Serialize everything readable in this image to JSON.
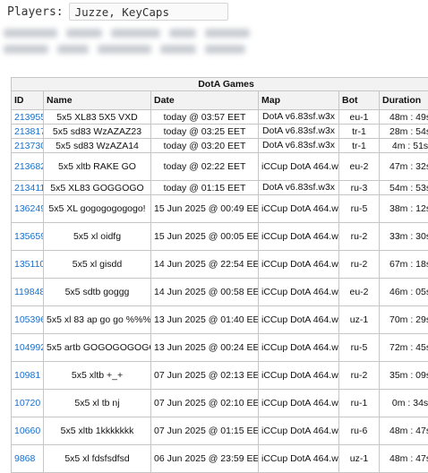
{
  "players": {
    "label": "Players:",
    "value": "Juzze, KeyCaps"
  },
  "table": {
    "caption": "DotA Games",
    "columns": [
      "ID",
      "Name",
      "Date",
      "Map",
      "Bot",
      "Duration"
    ],
    "rows": [
      {
        "id": "213955",
        "name": "5x5 XL83 5X5 VXD",
        "date": "today @ 03:57 EET",
        "map": "DotA v6.83sf.w3x",
        "bot": "eu-1",
        "duration": "48m : 49s"
      },
      {
        "id": "213817",
        "name": "5x5 sd83 WzAZAZ23",
        "date": "today @ 03:25 EET",
        "map": "DotA v6.83sf.w3x",
        "bot": "tr-1",
        "duration": "28m : 54s"
      },
      {
        "id": "213730",
        "name": "5x5 sd83 WzAZA14",
        "date": "today @ 03:20 EET",
        "map": "DotA v6.83sf.w3x",
        "bot": "tr-1",
        "duration": "4m : 51s"
      },
      {
        "id": "213682",
        "name": "5x5 xltb RAKE GO",
        "date": "today @ 02:22 EET",
        "map": "iCCup DotA 464.w3x",
        "bot": "eu-2",
        "duration": "47m : 32s"
      },
      {
        "id": "213411",
        "name": "5x5 XL83 GOGGOGO",
        "date": "today @ 01:15 EET",
        "map": "DotA v6.83sf.w3x",
        "bot": "ru-3",
        "duration": "54m : 53s"
      },
      {
        "id": "136249",
        "name": "5x5 XL gogogogogogo!",
        "date": "15 Jun 2025 @ 00:49 EET",
        "map": "iCCup DotA 464.w3x",
        "bot": "ru-5",
        "duration": "38m : 12s"
      },
      {
        "id": "135659",
        "name": "5x5 xl oidfg",
        "date": "15 Jun 2025 @ 00:05 EET",
        "map": "iCCup DotA 464.w3x",
        "bot": "ru-2",
        "duration": "33m : 30s"
      },
      {
        "id": "135110",
        "name": "5x5 xl gisdd",
        "date": "14 Jun 2025 @ 22:54 EET",
        "map": "iCCup DotA 464.w3x",
        "bot": "ru-2",
        "duration": "67m : 18s"
      },
      {
        "id": "119848",
        "name": "5x5 sdtb goggg",
        "date": "14 Jun 2025 @ 00:58 EET",
        "map": "iCCup DotA 464.w3x",
        "bot": "eu-2",
        "duration": "46m : 05s"
      },
      {
        "id": "105396",
        "name": "5x5 xl 83 ap go go %%%",
        "date": "13 Jun 2025 @ 01:40 EET",
        "map": "iCCup DotA 464.w3x",
        "bot": "uz-1",
        "duration": "70m : 29s"
      },
      {
        "id": "104992",
        "name": "5x5 artb GOGOGOGOGO",
        "date": "13 Jun 2025 @ 00:24 EET",
        "map": "iCCup DotA 464.w3x",
        "bot": "ru-5",
        "duration": "72m : 45s"
      },
      {
        "id": "10981",
        "name": "5x5 xltb +_+",
        "date": "07 Jun 2025 @ 02:13 EET",
        "map": "iCCup DotA 464.w3x",
        "bot": "ru-2",
        "duration": "35m : 09s"
      },
      {
        "id": "10720",
        "name": "5x5 xl tb nj",
        "date": "07 Jun 2025 @ 02:10 EET",
        "map": "iCCup DotA 464.w3x",
        "bot": "ru-1",
        "duration": "0m : 34s"
      },
      {
        "id": "10660",
        "name": "5x5 xltb 1kkkkkkk",
        "date": "07 Jun 2025 @ 01:15 EET",
        "map": "iCCup DotA 464.w3x",
        "bot": "ru-6",
        "duration": "48m : 47s"
      },
      {
        "id": "9868",
        "name": "5x5 xl fdsfsdfsd",
        "date": "06 Jun 2025 @ 23:59 EET",
        "map": "iCCup DotA 464.w3x",
        "bot": "uz-1",
        "duration": "48m : 47s"
      }
    ]
  },
  "colors": {
    "link": "#1a6fc9",
    "header_bg": "#f2f2f2",
    "border": "#c6c6c6"
  }
}
